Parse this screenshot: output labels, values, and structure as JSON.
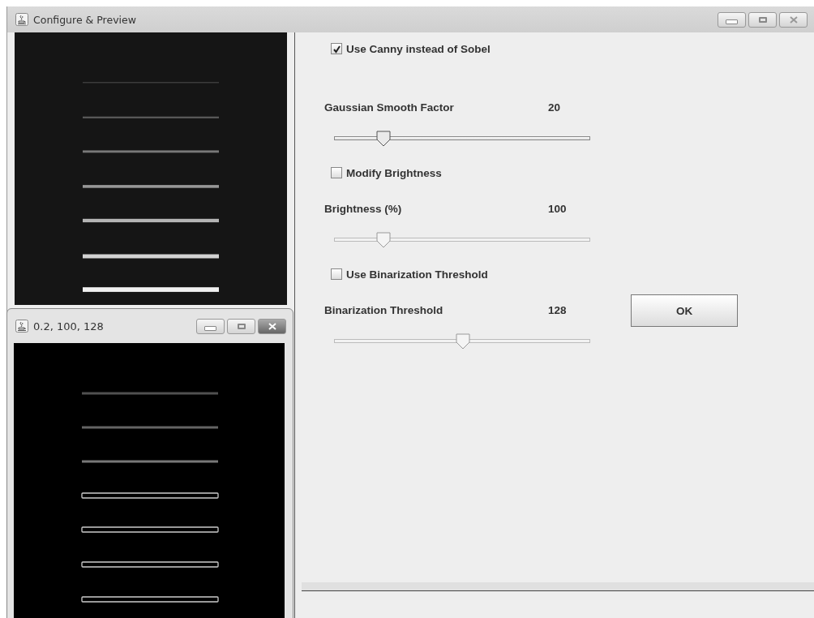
{
  "main_window": {
    "title": "Configure & Preview"
  },
  "controls": [
    {
      "kind": "checkbox",
      "label": "Use Canny instead of Sobel",
      "checked": true
    },
    {
      "kind": "slider",
      "label": "Gaussian Smooth Factor",
      "reading": "20",
      "level": 0.19,
      "disabled": false
    },
    {
      "kind": "checkbox",
      "label": "Modify Brightness",
      "checked": false
    },
    {
      "kind": "slider",
      "label": "Brightness (%)",
      "reading": "100",
      "level": 0.19,
      "disabled": true
    },
    {
      "kind": "checkbox",
      "label": "Use Binarization Threshold",
      "checked": false
    },
    {
      "kind": "slider",
      "label": "Binarization Threshold",
      "reading": "128",
      "level": 0.5,
      "disabled": true
    }
  ],
  "ok_button": {
    "label": "OK"
  },
  "preview_window": {
    "title": "0.2, 100, 128"
  }
}
